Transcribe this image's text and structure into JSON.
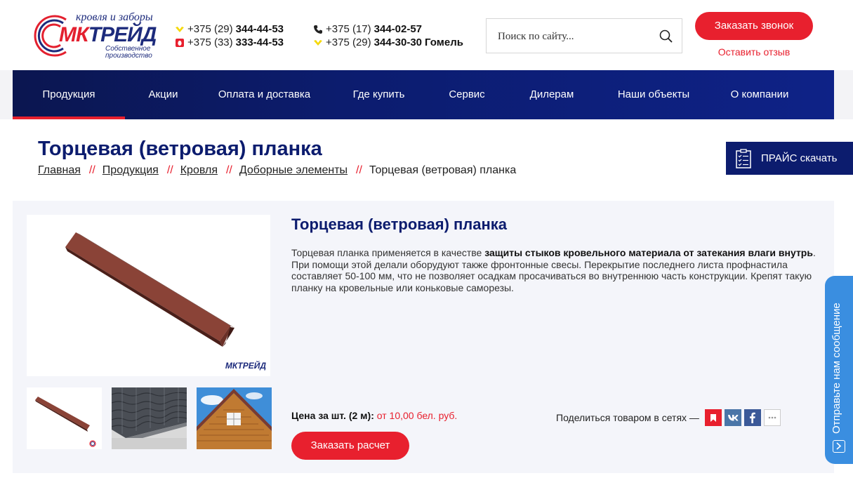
{
  "header": {
    "logo": {
      "tagline": "кровля и заборы",
      "name_part1": "МК",
      "name_part2": "ТРЕЙД",
      "subtitle": "Собственное производство"
    },
    "phones_left": [
      {
        "icon": "velcom-icon",
        "code": "+375 (29)",
        "number": "344-44-53"
      },
      {
        "icon": "mts-icon",
        "code": "+375 (33)",
        "number": "333-44-53"
      }
    ],
    "phones_right": [
      {
        "icon": "phone-icon",
        "code": "+375 (17)",
        "number": "344-02-57",
        "city": ""
      },
      {
        "icon": "velcom-icon",
        "code": "+375 (29)",
        "number": "344-30-30",
        "city": "Гомель"
      }
    ],
    "search": {
      "placeholder": "Поиск по сайту..."
    },
    "call_button": "Заказать звонок",
    "review_link": "Оставить отзыв"
  },
  "nav": {
    "items": [
      {
        "label": "Продукция",
        "active": true
      },
      {
        "label": "Акции"
      },
      {
        "label": "Оплата и доставка"
      },
      {
        "label": "Где купить"
      },
      {
        "label": "Сервис"
      },
      {
        "label": "Дилерам"
      },
      {
        "label": "Наши объекты"
      },
      {
        "label": "О компании"
      }
    ]
  },
  "page": {
    "title": "Торцевая (ветровая) планка",
    "breadcrumb": [
      {
        "label": "Главная"
      },
      {
        "label": "Продукция"
      },
      {
        "label": "Кровля"
      },
      {
        "label": "Доборные элементы"
      }
    ],
    "breadcrumb_separator": "//",
    "breadcrumb_current": "Торцевая (ветровая) планка",
    "price_button": "ПРАЙС скачать"
  },
  "product": {
    "title": "Торцевая (ветровая) планка",
    "desc_part1": "Торцевая планка применяется в качестве ",
    "desc_bold": "защиты стыков кровельного материала от затекания влаги внутрь",
    "desc_part2": ". При помощи этой делали оборудуют также фронтонные свесы. Перекрытие последнего листа профнастила составляет 50-100 мм, что не позволяет осадкам просачиваться во внутреннюю часть конструкции. Крепят такую планку на кровельные или коньковые саморезы.",
    "image_watermark": "МКТРЕЙД",
    "price_label": "Цена за шт. (2 м):",
    "price_value": "от 10,00 бел. руб.",
    "order_button": "Заказать расчет",
    "share_label": "Поделиться товаром в сетях —",
    "share_icons": [
      "bookmark-icon",
      "vk-icon",
      "facebook-icon",
      "more-icon"
    ],
    "colors": {
      "plank": "#7a3b30",
      "brand_blue": "#0c1c6e",
      "brand_red": "#e8202e"
    }
  },
  "widget": {
    "label": "Отправьте нам сообщение"
  }
}
